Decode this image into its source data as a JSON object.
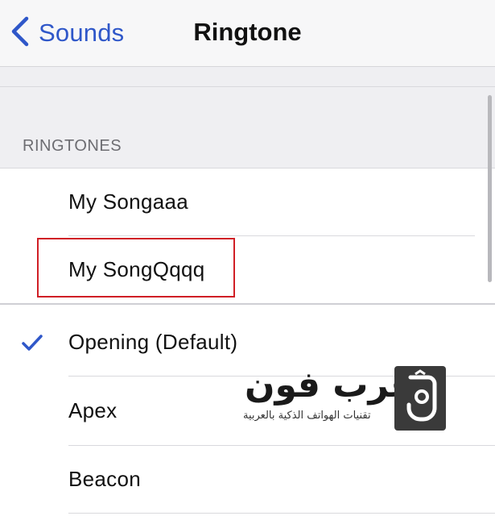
{
  "nav": {
    "back_label": "Sounds",
    "title": "Ringtone"
  },
  "section": {
    "header": "RINGTONES"
  },
  "custom_ringtones": [
    {
      "label": "My Songaaa",
      "selected": false
    },
    {
      "label": "My SongQqqq",
      "selected": false,
      "highlighted": true
    }
  ],
  "builtin_ringtones": [
    {
      "label": "Opening (Default)",
      "selected": true
    },
    {
      "label": "Apex",
      "selected": false
    },
    {
      "label": "Beacon",
      "selected": false
    }
  ],
  "watermark": {
    "name": "عرب فون",
    "tagline": "تقنيات الهواتف الذكية بالعربية"
  },
  "colors": {
    "accent": "#2f57c9",
    "highlight_box": "#d01f26",
    "grouped_background": "#efeff2"
  }
}
